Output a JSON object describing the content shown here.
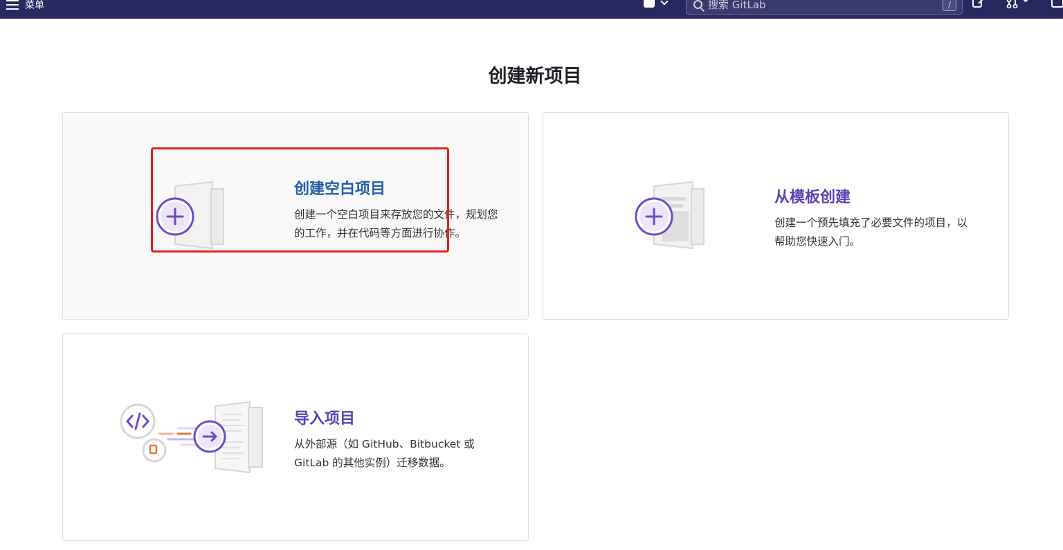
{
  "navbar": {
    "menu_label": "菜单",
    "search_placeholder": "搜索 GitLab",
    "search_shortcut": "/"
  },
  "page": {
    "title": "创建新项目"
  },
  "panels": [
    {
      "id": "blank",
      "title": "创建空白项目",
      "description": "创建一个空白项目来存放您的文件，规划您的工作，并在代码等方面进行协作。"
    },
    {
      "id": "template",
      "title": "从模板创建",
      "description": "创建一个预先填充了必要文件的项目，以帮助您快速入门。"
    },
    {
      "id": "import",
      "title": "导入项目",
      "description": "从外部源（如 GitHub、Bitbucket 或 GitLab 的其他实例）迁移数据。"
    }
  ],
  "colors": {
    "navbar_bg": "#292961",
    "accent_purple": "#6e49cb",
    "title_blue": "#1f5ea8",
    "highlight_red": "#ee1c1c"
  }
}
